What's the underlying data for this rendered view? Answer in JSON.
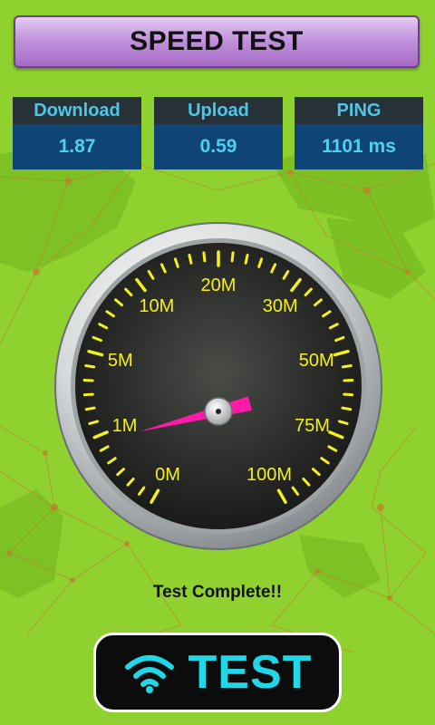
{
  "header": {
    "title": "SPEED TEST"
  },
  "stats": [
    {
      "label": "Download",
      "value": "1.87"
    },
    {
      "label": "Upload",
      "value": "0.59"
    },
    {
      "label": "PING",
      "value": "1101 ms"
    }
  ],
  "gauge": {
    "scale_labels": [
      "0M",
      "1M",
      "5M",
      "10M",
      "20M",
      "30M",
      "50M",
      "75M",
      "100M"
    ],
    "needle_value_mbps": 1.87,
    "needle_color": "#ff1aa8",
    "tick_color": "#f3f01b",
    "label_color": "#f3f01b"
  },
  "status": {
    "text": "Test Complete!!"
  },
  "test_button": {
    "label": "TEST",
    "icon": "wifi-icon",
    "accent": "#1fd7e6"
  },
  "colors": {
    "background": "#8fd12e",
    "stat_header": "#263238",
    "stat_body": "#0f4576"
  }
}
